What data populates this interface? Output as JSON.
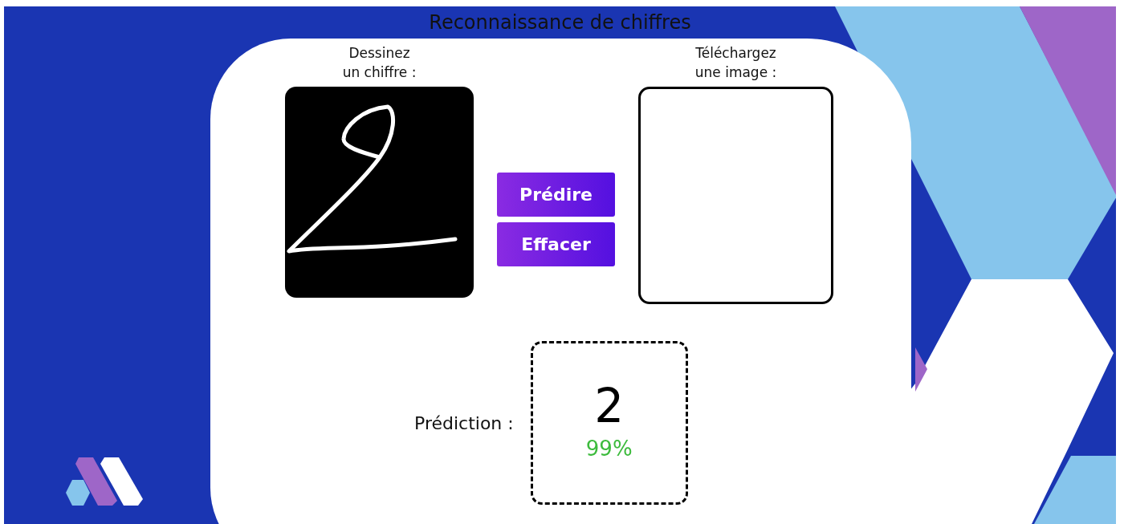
{
  "title": "Reconnaissance de chiffres",
  "draw_label": "Dessinez\nun chiffre :",
  "upload_label": "Téléchargez\nune image :",
  "buttons": [
    "Prédire",
    "Effacer"
  ],
  "prediction": {
    "label": "Prédiction :",
    "digit": "2",
    "confidence": "99%"
  }
}
